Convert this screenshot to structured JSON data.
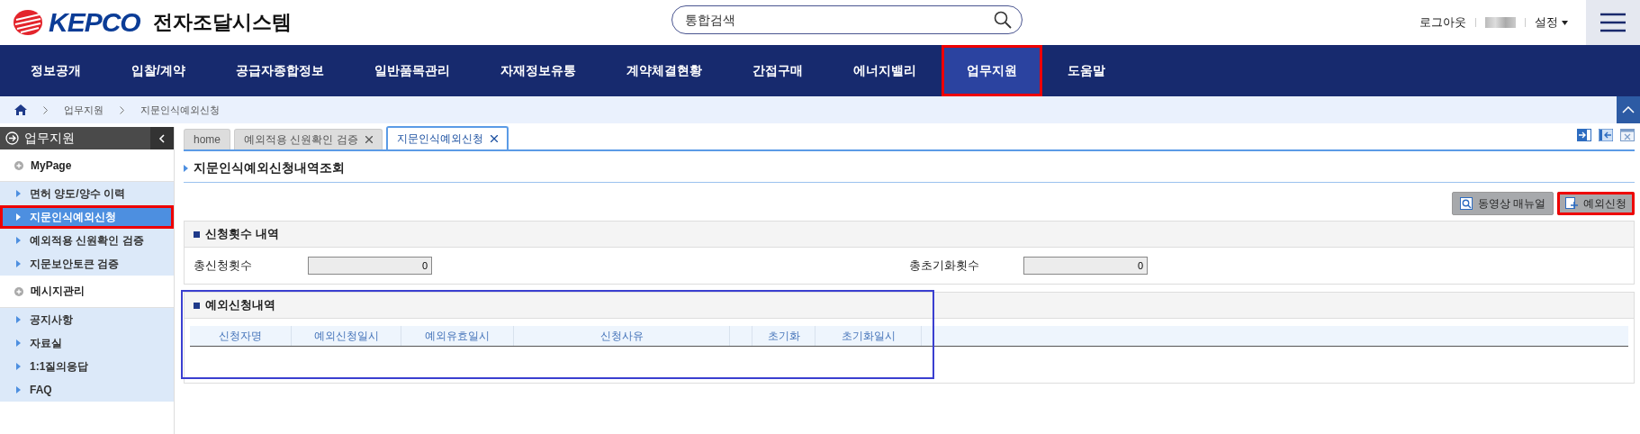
{
  "header": {
    "logo": "KEPCO",
    "system_title": "전자조달시스템",
    "search": {
      "placeholder": "통합검색"
    },
    "links": [
      "로그아웃",
      "설정"
    ]
  },
  "nav": [
    {
      "label": "정보공개",
      "selected": false,
      "highlighted": false
    },
    {
      "label": "입찰/계약",
      "selected": false,
      "highlighted": false
    },
    {
      "label": "공급자종합정보",
      "selected": false,
      "highlighted": false
    },
    {
      "label": "일반품목관리",
      "selected": false,
      "highlighted": false
    },
    {
      "label": "자재정보유통",
      "selected": false,
      "highlighted": false
    },
    {
      "label": "계약체결현황",
      "selected": false,
      "highlighted": false
    },
    {
      "label": "간접구매",
      "selected": false,
      "highlighted": false
    },
    {
      "label": "에너지밸리",
      "selected": false,
      "highlighted": false
    },
    {
      "label": "업무지원",
      "selected": true,
      "highlighted": true
    },
    {
      "label": "도움말",
      "selected": false,
      "highlighted": false
    }
  ],
  "breadcrumb": [
    "업무지원",
    "지문인식예외신청"
  ],
  "sidebar": {
    "title": "업무지원",
    "groups": [
      {
        "label": "MyPage",
        "children": [
          {
            "label": "면허 양도/양수 이력",
            "selected": false,
            "highlighted": false
          },
          {
            "label": "지문인식예외신청",
            "selected": true,
            "highlighted": true
          },
          {
            "label": "예외적용 신원확인 검증",
            "selected": false,
            "highlighted": false
          },
          {
            "label": "지문보안토큰 검증",
            "selected": false,
            "highlighted": false
          }
        ]
      },
      {
        "label": "메시지관리",
        "children": [
          {
            "label": "공지사항",
            "selected": false,
            "highlighted": false
          },
          {
            "label": "자료실",
            "selected": false,
            "highlighted": false
          },
          {
            "label": "1:1질의응답",
            "selected": false,
            "highlighted": false
          },
          {
            "label": "FAQ",
            "selected": false,
            "highlighted": false
          }
        ]
      }
    ]
  },
  "tabs": [
    {
      "label": "home",
      "selected": false,
      "closable": false
    },
    {
      "label": "예외적용 신원확인 검증",
      "selected": false,
      "closable": true
    },
    {
      "label": "지문인식예외신청",
      "selected": true,
      "closable": true
    }
  ],
  "page_title": "지문인식예외신청내역조회",
  "buttons": [
    {
      "label": "동영상 매뉴얼",
      "kind": "video",
      "highlighted": false
    },
    {
      "label": "예외신청",
      "kind": "add",
      "highlighted": true
    }
  ],
  "summary": {
    "title": "신청횟수 내역",
    "fields": [
      {
        "label": "총신청횟수",
        "value": "0"
      },
      {
        "label": "총초기화횟수",
        "value": "0"
      }
    ]
  },
  "table": {
    "title": "예외신청내역",
    "outlined": true,
    "columns": [
      "신청자명",
      "예외신청일시",
      "예외유효일시",
      "신청사유",
      "",
      "초기화",
      "초기화일시"
    ]
  }
}
